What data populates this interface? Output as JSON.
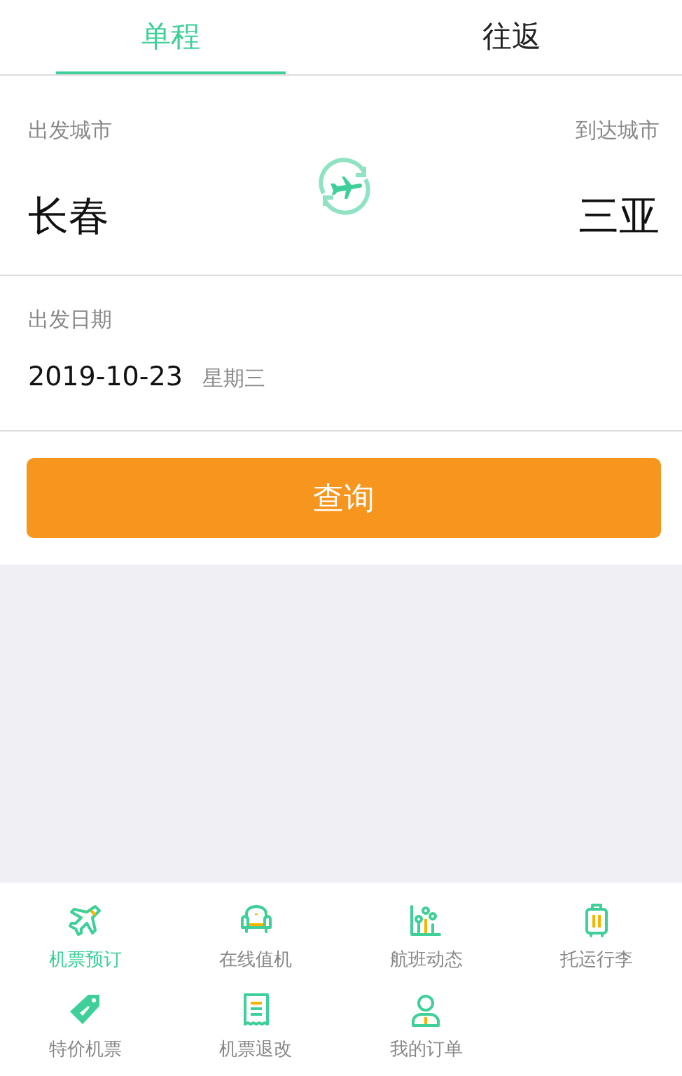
{
  "tabs": [
    {
      "label": "单程",
      "selected": true
    },
    {
      "label": "往返",
      "selected": false
    }
  ],
  "route": {
    "from_label": "出发城市",
    "from_city": "长春",
    "to_label": "到达城市",
    "to_city": "三亚"
  },
  "date": {
    "label": "出发日期",
    "value": "2019-10-23",
    "weekday": "星期三"
  },
  "search_button": "查询",
  "services": [
    {
      "label": "机票预订",
      "kind": "plane",
      "selected": true
    },
    {
      "label": "在线值机",
      "kind": "seat",
      "selected": false
    },
    {
      "label": "航班动态",
      "kind": "chart",
      "selected": false
    },
    {
      "label": "托运行李",
      "kind": "luggage",
      "selected": false
    },
    {
      "label": "特价机票",
      "kind": "tag",
      "selected": false
    },
    {
      "label": "机票退改",
      "kind": "receipt",
      "selected": false
    },
    {
      "label": "我的订单",
      "kind": "person",
      "selected": false
    }
  ]
}
